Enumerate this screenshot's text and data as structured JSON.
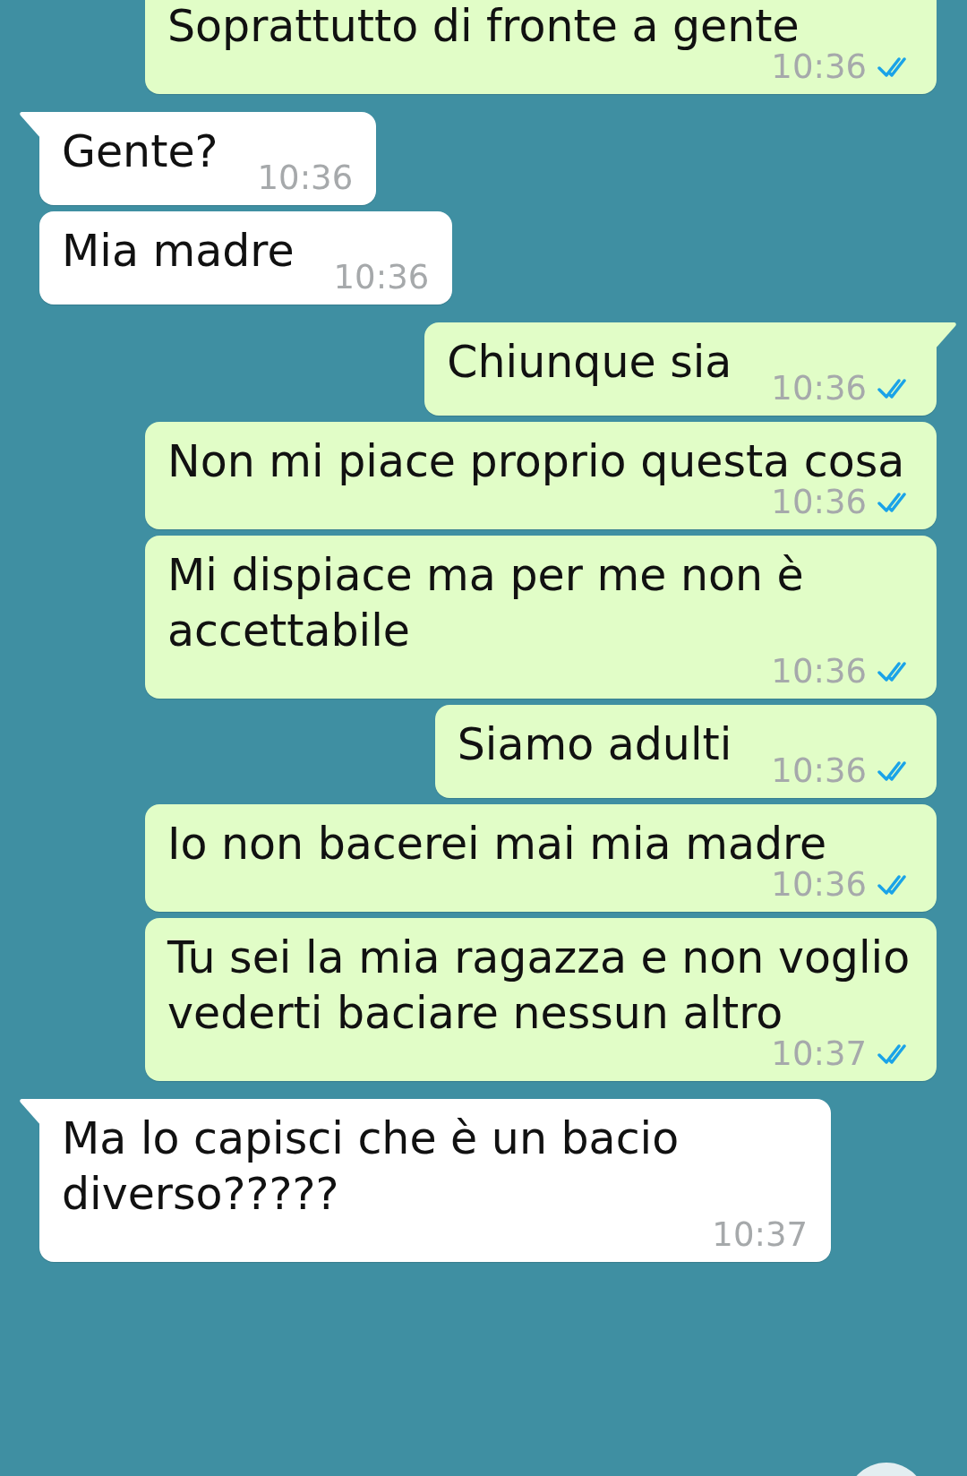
{
  "messages": [
    {
      "kind": "outgoing",
      "tail": false,
      "text": "Soprattutto di fronte a gente",
      "time": "10:36",
      "read": true
    },
    {
      "kind": "incoming",
      "tail": true,
      "text": "Gente?",
      "time": "10:36"
    },
    {
      "kind": "incoming",
      "tail": false,
      "text": "Mia madre",
      "time": "10:36"
    },
    {
      "kind": "outgoing",
      "tail": true,
      "text": "Chiunque sia",
      "time": "10:36",
      "read": true
    },
    {
      "kind": "outgoing",
      "tail": false,
      "text": "Non mi piace proprio questa cosa",
      "time": "10:36",
      "read": true
    },
    {
      "kind": "outgoing",
      "tail": false,
      "text": "Mi dispiace ma per me non è accettabile",
      "time": "10:36",
      "read": true
    },
    {
      "kind": "outgoing",
      "tail": false,
      "text": "Siamo adulti",
      "time": "10:36",
      "read": true
    },
    {
      "kind": "outgoing",
      "tail": false,
      "text": "Io non bacerei mai mia madre",
      "time": "10:36",
      "read": true
    },
    {
      "kind": "outgoing",
      "tail": false,
      "text": "Tu sei la mia ragazza e non voglio vederti baciare nessun altro",
      "time": "10:37",
      "read": true
    },
    {
      "kind": "incoming",
      "tail": true,
      "text": "Ma lo capisci che è un bacio diverso?????",
      "time": "10:37"
    }
  ]
}
